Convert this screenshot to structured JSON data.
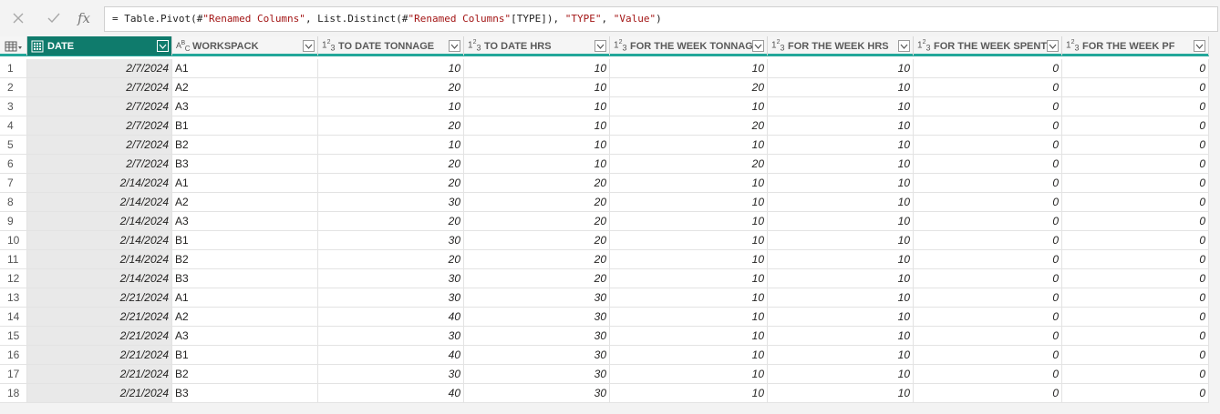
{
  "formula_bar": {
    "cancel_icon": "close-icon",
    "commit_icon": "checkmark-icon",
    "fx_label": "fx",
    "formula_prefix": "= Table.Pivot(#",
    "formula_s1": "\"Renamed Columns\"",
    "formula_mid1": ", List.Distinct(#",
    "formula_s2": "\"Renamed Columns\"",
    "formula_mid2": "[TYPE]), ",
    "formula_s3": "\"TYPE\"",
    "formula_mid3": ", ",
    "formula_s4": "\"Value\"",
    "formula_suffix": ")"
  },
  "grid": {
    "accent_color": "#23a79a",
    "selected_header_color": "#0f7b6c",
    "columns": [
      {
        "name": "DATE",
        "type_icon": "date-icon",
        "type_label": "",
        "selected": true
      },
      {
        "name": "WORKSPACK",
        "type_icon": "text-type-icon",
        "type_label": "ABC",
        "selected": false
      },
      {
        "name": "TO DATE TONNAGE",
        "type_icon": "number-type-icon",
        "type_label": "123",
        "selected": false
      },
      {
        "name": "TO DATE HRS",
        "type_icon": "number-type-icon",
        "type_label": "123",
        "selected": false
      },
      {
        "name": "FOR THE WEEK TONNAGE",
        "type_icon": "number-type-icon",
        "type_label": "123",
        "selected": false
      },
      {
        "name": "FOR THE WEEK HRS",
        "type_icon": "number-type-icon",
        "type_label": "123",
        "selected": false
      },
      {
        "name": "FOR THE WEEK SPENT",
        "type_icon": "number-type-icon",
        "type_label": "123",
        "selected": false
      },
      {
        "name": "FOR THE WEEK PF",
        "type_icon": "number-type-icon",
        "type_label": "123",
        "selected": false
      }
    ],
    "rows": [
      [
        "1",
        "2/7/2024",
        "A1",
        "10",
        "10",
        "10",
        "10",
        "0",
        "0"
      ],
      [
        "2",
        "2/7/2024",
        "A2",
        "20",
        "10",
        "20",
        "10",
        "0",
        "0"
      ],
      [
        "3",
        "2/7/2024",
        "A3",
        "10",
        "10",
        "10",
        "10",
        "0",
        "0"
      ],
      [
        "4",
        "2/7/2024",
        "B1",
        "20",
        "10",
        "20",
        "10",
        "0",
        "0"
      ],
      [
        "5",
        "2/7/2024",
        "B2",
        "10",
        "10",
        "10",
        "10",
        "0",
        "0"
      ],
      [
        "6",
        "2/7/2024",
        "B3",
        "20",
        "10",
        "20",
        "10",
        "0",
        "0"
      ],
      [
        "7",
        "2/14/2024",
        "A1",
        "20",
        "20",
        "10",
        "10",
        "0",
        "0"
      ],
      [
        "8",
        "2/14/2024",
        "A2",
        "30",
        "20",
        "10",
        "10",
        "0",
        "0"
      ],
      [
        "9",
        "2/14/2024",
        "A3",
        "20",
        "20",
        "10",
        "10",
        "0",
        "0"
      ],
      [
        "10",
        "2/14/2024",
        "B1",
        "30",
        "20",
        "10",
        "10",
        "0",
        "0"
      ],
      [
        "11",
        "2/14/2024",
        "B2",
        "20",
        "20",
        "10",
        "10",
        "0",
        "0"
      ],
      [
        "12",
        "2/14/2024",
        "B3",
        "30",
        "20",
        "10",
        "10",
        "0",
        "0"
      ],
      [
        "13",
        "2/21/2024",
        "A1",
        "30",
        "30",
        "10",
        "10",
        "0",
        "0"
      ],
      [
        "14",
        "2/21/2024",
        "A2",
        "40",
        "30",
        "10",
        "10",
        "0",
        "0"
      ],
      [
        "15",
        "2/21/2024",
        "A3",
        "30",
        "30",
        "10",
        "10",
        "0",
        "0"
      ],
      [
        "16",
        "2/21/2024",
        "B1",
        "40",
        "30",
        "10",
        "10",
        "0",
        "0"
      ],
      [
        "17",
        "2/21/2024",
        "B2",
        "30",
        "30",
        "10",
        "10",
        "0",
        "0"
      ],
      [
        "18",
        "2/21/2024",
        "B3",
        "40",
        "30",
        "10",
        "10",
        "0",
        "0"
      ]
    ]
  }
}
